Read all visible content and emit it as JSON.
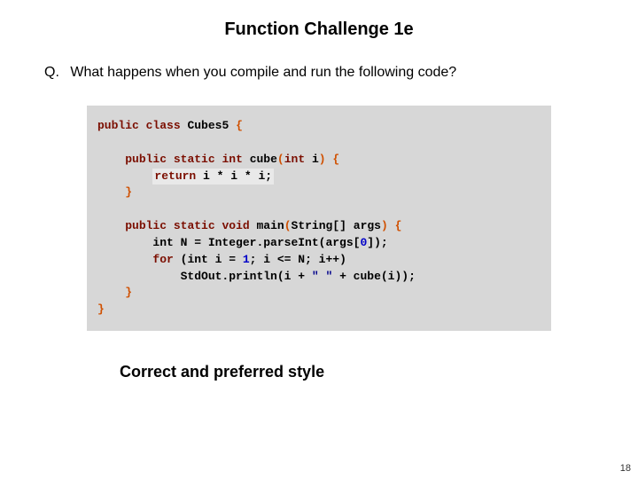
{
  "title": "Function Challenge 1e",
  "question": {
    "prefix": "Q.",
    "text": "What happens when you compile and run the following code?"
  },
  "code": {
    "kw_public": "public",
    "kw_class": "class",
    "cls_name": "Cubes5",
    "obrace": "{",
    "cbrace": "}",
    "kw_static": "static",
    "tp_int": "int",
    "fn_cube": "cube",
    "param_open": "(",
    "param_close": ")",
    "param_int": "int",
    "param_i": "i",
    "ret": "return",
    "expr_part": "i * i * i;",
    "tp_void": "void",
    "fn_main": "main",
    "str_arr": "String[]",
    "args": "args",
    "line_n": "int N = Integer.parseInt(args[",
    "zero": "0",
    "line_n_tail": "]);",
    "for_kw": "for",
    "for_head_a": "(int i = ",
    "one": "1",
    "for_head_b": "; i <= N; i++)",
    "print_a": "StdOut.println(i + ",
    "str_sp": "\" \"",
    "print_b": " + cube(i));"
  },
  "answer": "Correct and preferred style",
  "page": "18"
}
